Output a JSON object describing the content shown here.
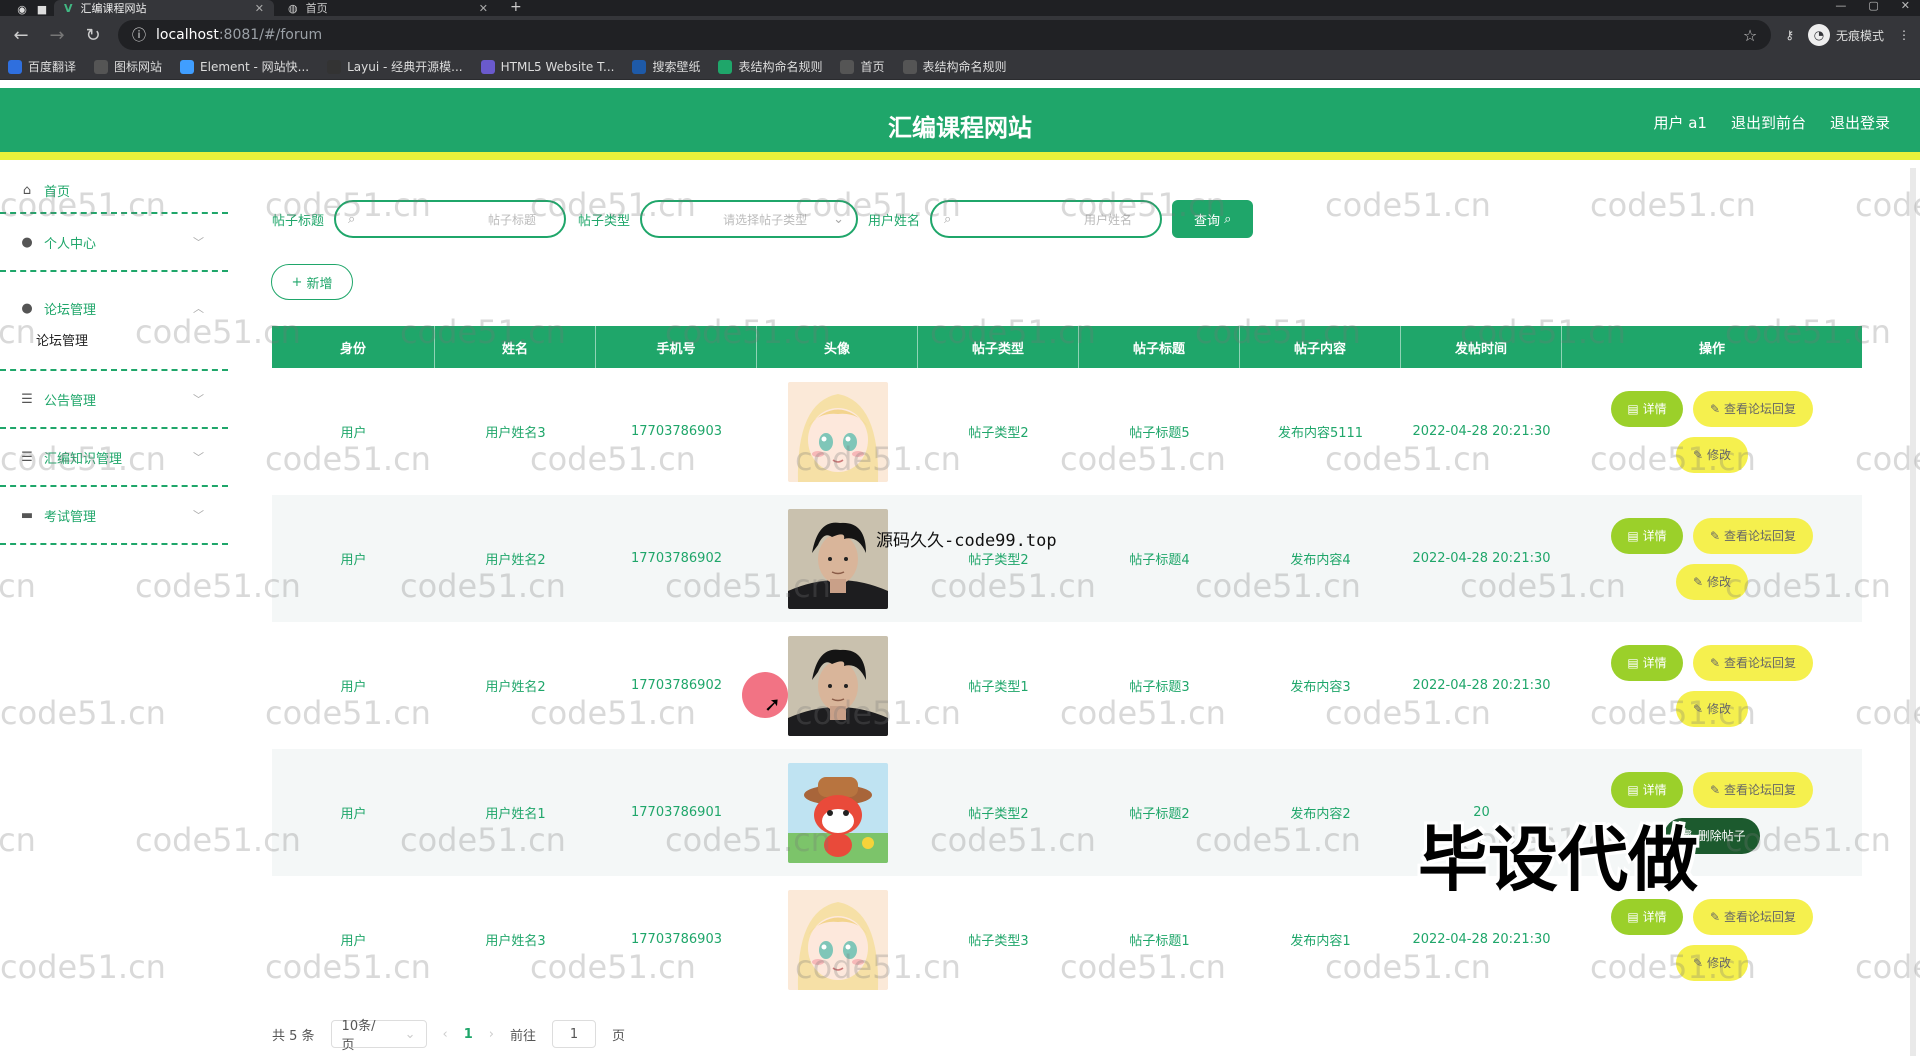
{
  "browser": {
    "tabs": [
      {
        "title": "汇编课程网站",
        "active": true
      },
      {
        "title": "首页",
        "active": false
      }
    ],
    "url_host": "localhost",
    "url_rest": ":8081/#/forum",
    "incognito_label": "无痕模式",
    "bookmarks": [
      {
        "label": "百度翻译",
        "color": "#2f6fde"
      },
      {
        "label": "图标网站",
        "color": "#555555"
      },
      {
        "label": "Element - 网站快...",
        "color": "#409eff"
      },
      {
        "label": "Layui - 经典开源模...",
        "color": "#333333"
      },
      {
        "label": "HTML5 Website T...",
        "color": "#6a5acd"
      },
      {
        "label": "搜索壁纸",
        "color": "#1e5aa8"
      },
      {
        "label": "表结构命名规则",
        "color": "#1fa66a"
      },
      {
        "label": "首页",
        "color": "#555555"
      },
      {
        "label": "表结构命名规则",
        "color": "#555555"
      }
    ]
  },
  "header": {
    "title": "汇编课程网站",
    "user": "用户 a1",
    "back_front": "退出到前台",
    "logout": "退出登录"
  },
  "sidebar": {
    "items": [
      {
        "label": "首页",
        "icon": "home-icon"
      },
      {
        "label": "个人中心",
        "icon": "user-icon"
      },
      {
        "label": "论坛管理",
        "icon": "user-icon",
        "expanded": true,
        "sub": "论坛管理"
      },
      {
        "label": "公告管理",
        "icon": "list-icon"
      },
      {
        "label": "汇编知识管理",
        "icon": "list-icon"
      },
      {
        "label": "考试管理",
        "icon": "car-icon"
      }
    ]
  },
  "search": {
    "title_label": "帖子标题",
    "title_placeholder": "帖子标题",
    "type_label": "帖子类型",
    "type_placeholder": "请选择帖子类型",
    "user_label": "用户姓名",
    "user_placeholder": "用户姓名",
    "query_button": "查询"
  },
  "add_button": "新增",
  "table": {
    "headers": [
      "身份",
      "姓名",
      "手机号",
      "头像",
      "帖子类型",
      "帖子标题",
      "帖子内容",
      "发帖时间",
      "操作"
    ],
    "rows": [
      {
        "role": "用户",
        "name": "用户姓名3",
        "phone": "17703786903",
        "avatar": "anime-girl",
        "type": "帖子类型2",
        "title": "帖子标题5",
        "content": "发布内容5111",
        "time": "2022-04-28 20:21:30"
      },
      {
        "role": "用户",
        "name": "用户姓名2",
        "phone": "17703786902",
        "avatar": "man-photo",
        "type": "帖子类型2",
        "title": "帖子标题4",
        "content": "发布内容4",
        "time": "2022-04-28 20:21:30"
      },
      {
        "role": "用户",
        "name": "用户姓名2",
        "phone": "17703786902",
        "avatar": "man-photo",
        "type": "帖子类型1",
        "title": "帖子标题3",
        "content": "发布内容3",
        "time": "2022-04-28 20:21:30"
      },
      {
        "role": "用户",
        "name": "用户姓名1",
        "phone": "17703786901",
        "avatar": "cartoon-cat",
        "type": "帖子类型2",
        "title": "帖子标题2",
        "content": "发布内容2",
        "time": "20"
      },
      {
        "role": "用户",
        "name": "用户姓名3",
        "phone": "17703786903",
        "avatar": "anime-girl",
        "type": "帖子类型3",
        "title": "帖子标题1",
        "content": "发布内容1",
        "time": "2022-04-28 20:21:30"
      }
    ],
    "ops": {
      "detail": "详情",
      "reply": "查看论坛回复",
      "edit": "修改",
      "delete": "删除帖子"
    }
  },
  "pagination": {
    "total": "共 5 条",
    "page_size": "10条/页",
    "current": "1",
    "goto_prefix": "前往",
    "goto_value": "1",
    "goto_suffix": "页"
  },
  "overlays": {
    "watermark": "code51.cn",
    "site_tag": "源码久久-code99.top",
    "big_text": "毕设代做"
  },
  "colors": {
    "primary": "#1fa66a",
    "accent_yellow": "#e9f23b",
    "detail_green": "#9bd02a",
    "button_yellow": "#f5f04e"
  }
}
